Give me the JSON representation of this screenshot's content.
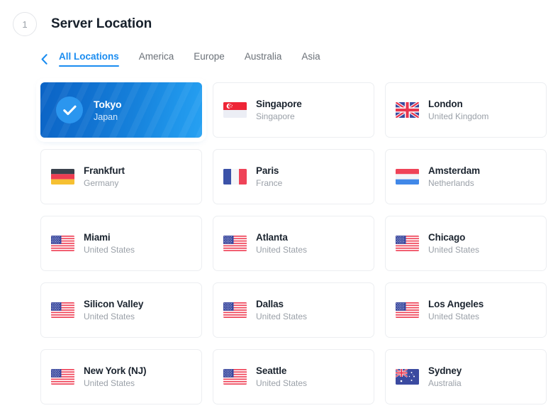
{
  "header": {
    "step_number": "1",
    "title": "Server Location"
  },
  "nav": {
    "back_icon": "chevron-left-icon",
    "tabs": [
      {
        "label": "All Locations",
        "active": true
      },
      {
        "label": "America",
        "active": false
      },
      {
        "label": "Europe",
        "active": false
      },
      {
        "label": "Australia",
        "active": false
      },
      {
        "label": "Asia",
        "active": false
      }
    ]
  },
  "colors": {
    "accent": "#1a8cf0",
    "selected_gradient_start": "#0b63c5",
    "selected_gradient_end": "#27a1f2",
    "title_text": "#17202b",
    "muted_text": "#9aa0a8",
    "card_border": "#eceef1"
  },
  "locations": [
    {
      "city": "Tokyo",
      "country": "Japan",
      "flag": "flag-jp",
      "selected": true,
      "check_icon": "check-icon"
    },
    {
      "city": "Singapore",
      "country": "Singapore",
      "flag": "flag-sg",
      "selected": false
    },
    {
      "city": "London",
      "country": "United Kingdom",
      "flag": "flag-gb",
      "selected": false
    },
    {
      "city": "Frankfurt",
      "country": "Germany",
      "flag": "flag-de",
      "selected": false
    },
    {
      "city": "Paris",
      "country": "France",
      "flag": "flag-fr",
      "selected": false
    },
    {
      "city": "Amsterdam",
      "country": "Netherlands",
      "flag": "flag-nl",
      "selected": false
    },
    {
      "city": "Miami",
      "country": "United States",
      "flag": "flag-us",
      "selected": false
    },
    {
      "city": "Atlanta",
      "country": "United States",
      "flag": "flag-us",
      "selected": false
    },
    {
      "city": "Chicago",
      "country": "United States",
      "flag": "flag-us",
      "selected": false
    },
    {
      "city": "Silicon Valley",
      "country": "United States",
      "flag": "flag-us",
      "selected": false
    },
    {
      "city": "Dallas",
      "country": "United States",
      "flag": "flag-us",
      "selected": false
    },
    {
      "city": "Los Angeles",
      "country": "United States",
      "flag": "flag-us",
      "selected": false
    },
    {
      "city": "New York (NJ)",
      "country": "United States",
      "flag": "flag-us",
      "selected": false
    },
    {
      "city": "Seattle",
      "country": "United States",
      "flag": "flag-us",
      "selected": false
    },
    {
      "city": "Sydney",
      "country": "Australia",
      "flag": "flag-au",
      "selected": false
    }
  ]
}
